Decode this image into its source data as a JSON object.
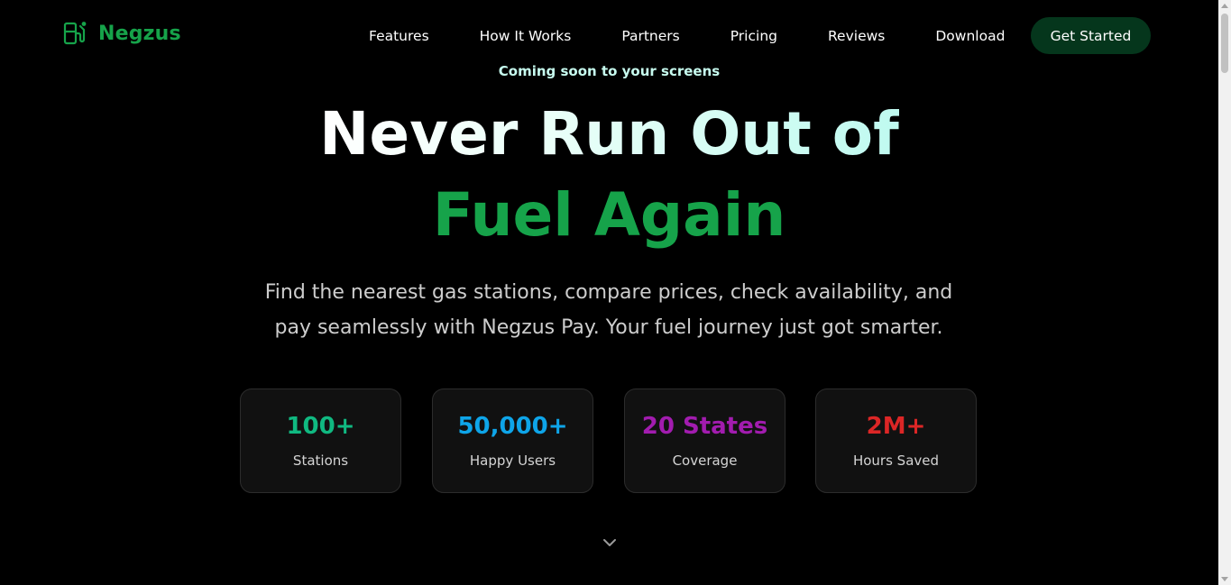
{
  "brand": {
    "name": "Negzus",
    "logo_icon": "fuel-pump-icon",
    "color": "#16a34a"
  },
  "nav": {
    "items": [
      {
        "label": "Features"
      },
      {
        "label": "How It Works"
      },
      {
        "label": "Partners"
      },
      {
        "label": "Pricing"
      },
      {
        "label": "Reviews"
      },
      {
        "label": "Download"
      }
    ],
    "cta_label": "Get Started",
    "cta_color": "#05361c"
  },
  "hero": {
    "eyebrow": "Coming soon to your screens",
    "headline_line1": "Never Run Out of",
    "headline_line2": "Fuel Again",
    "subtitle": "Find the nearest gas stations, compare prices, check availability, and pay seamlessly with Negzus Pay. Your fuel journey just got smarter."
  },
  "stats": [
    {
      "value": "100+",
      "label": "Stations",
      "color": "#10b981"
    },
    {
      "value": "50,000+",
      "label": "Happy Users",
      "color": "#0ea5e9"
    },
    {
      "value": "20 States",
      "label": "Coverage",
      "color": "#a21caf"
    },
    {
      "value": "2M+",
      "label": "Hours Saved",
      "color": "#dc2626"
    }
  ],
  "scroll_indicator_icon": "chevron-down-icon"
}
